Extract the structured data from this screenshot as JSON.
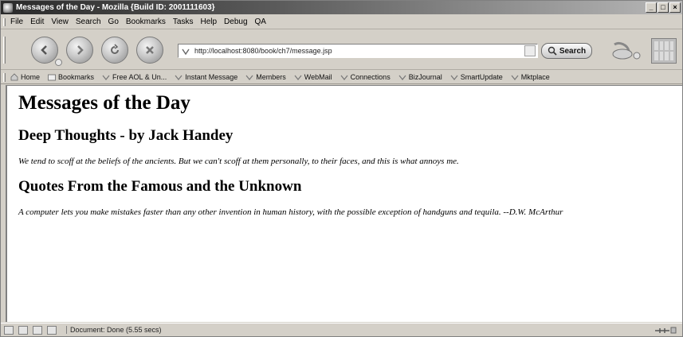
{
  "window": {
    "title": "Messages of the Day - Mozilla {Build ID: 2001111603}",
    "controls": [
      "_",
      "□",
      "×"
    ]
  },
  "menubar": {
    "items": [
      "File",
      "Edit",
      "View",
      "Search",
      "Go",
      "Bookmarks",
      "Tasks",
      "Help",
      "Debug",
      "QA"
    ]
  },
  "navbar": {
    "url": "http://localhost:8080/book/ch7/message.jsp",
    "search_label": "Search"
  },
  "personal_toolbar": {
    "items": [
      "Home",
      "Bookmarks",
      "Free AOL & Un...",
      "Instant Message",
      "Members",
      "WebMail",
      "Connections",
      "BizJournal",
      "SmartUpdate",
      "Mktplace"
    ]
  },
  "page": {
    "heading": "Messages of the Day",
    "sections": [
      {
        "title": "Deep Thoughts - by Jack Handey",
        "text": "We tend to scoff at the beliefs of the ancients. But we can't scoff at them personally, to their faces, and this is what annoys me."
      },
      {
        "title": "Quotes From the Famous and the Unknown",
        "text": "A computer lets you make mistakes faster than any other invention in human history, with the possible exception of handguns and tequila. --D.W. McArthur"
      }
    ]
  },
  "statusbar": {
    "text": "Document: Done (5.55 secs)"
  }
}
